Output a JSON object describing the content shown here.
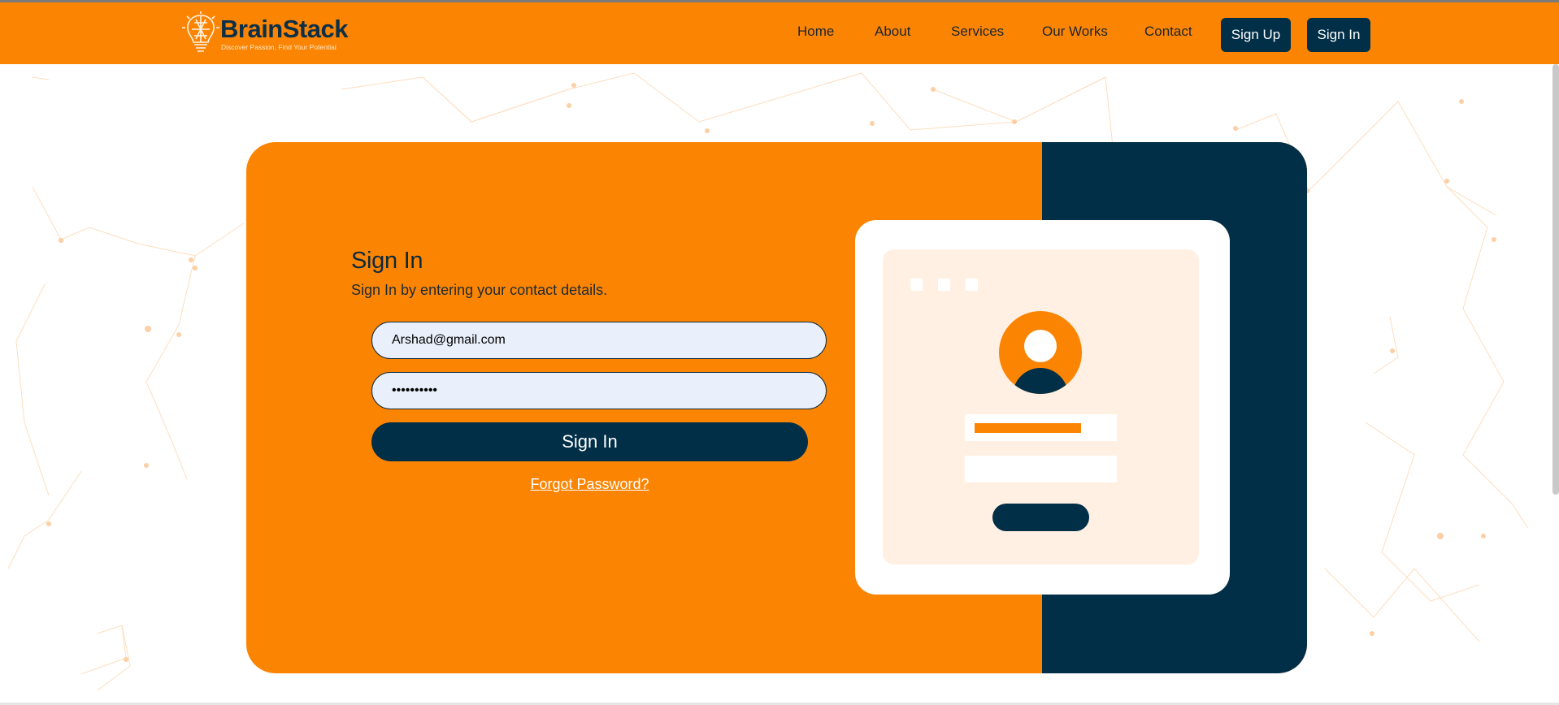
{
  "brand": {
    "name": "BrainStack",
    "tagline": "Discover Passion, Find Your Potential",
    "icon": "brain-bulb-logo-icon"
  },
  "nav": {
    "links": [
      "Home",
      "About",
      "Services",
      "Our Works",
      "Contact"
    ],
    "signup_label": "Sign Up",
    "signin_label": "Sign In"
  },
  "signin": {
    "title": "Sign In",
    "subtitle": "Sign In by entering your contact details.",
    "email_value": "Arshad@gmail.com",
    "password_value": "••••••••••",
    "button_label": "Sign In",
    "forgot_label": "Forgot Password?"
  },
  "illustration": {
    "icon": "user-login-illustration"
  },
  "colors": {
    "accent": "#fb8503",
    "dark": "#002f47",
    "input_bg": "#e9f0fb",
    "illustration_bg": "#fff0e3"
  }
}
